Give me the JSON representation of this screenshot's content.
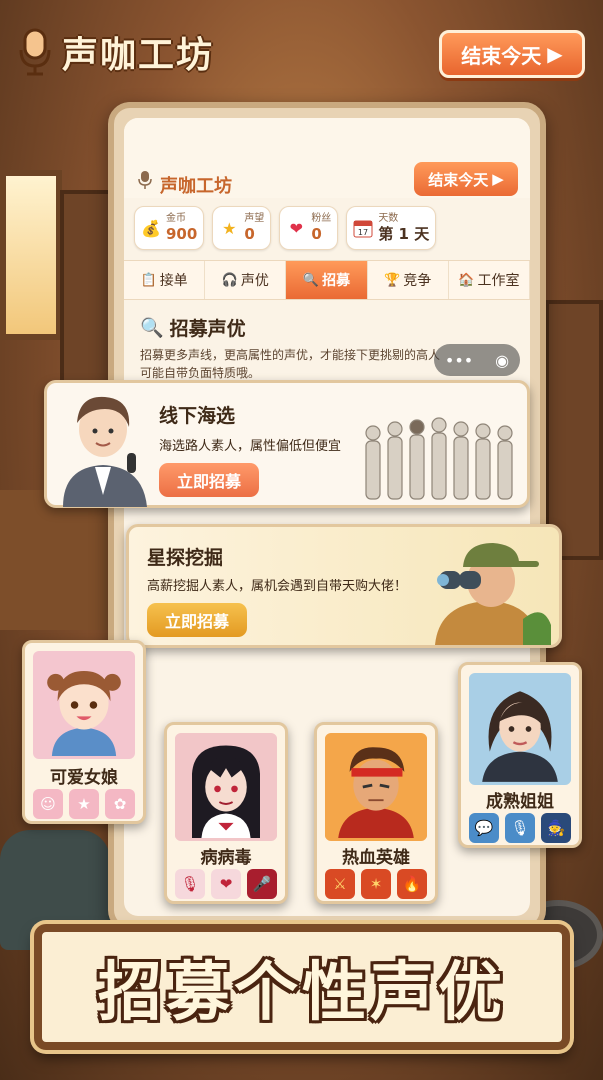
{
  "header": {
    "title": "声咖工坊",
    "end_day_label": "结束今天"
  },
  "app": {
    "title": "声咖工坊",
    "end_day_label": "结束今天"
  },
  "stats": [
    {
      "label": "金币",
      "value": "900",
      "icon": "money-bag-icon"
    },
    {
      "label": "声望",
      "value": "0",
      "icon": "star-icon"
    },
    {
      "label": "粉丝",
      "value": "0",
      "icon": "heart-icon"
    },
    {
      "label": "天数",
      "value": "第 1 天",
      "icon": "calendar-icon",
      "calendar_text": "17"
    }
  ],
  "tabs": [
    {
      "label": "接单",
      "icon": "clipboard-icon",
      "active": false
    },
    {
      "label": "声优",
      "icon": "headphones-icon",
      "active": false
    },
    {
      "label": "招募",
      "icon": "search-icon",
      "active": true
    },
    {
      "label": "竞争",
      "icon": "trophy-icon",
      "active": false
    },
    {
      "label": "工作室",
      "icon": "studio-icon",
      "active": false
    }
  ],
  "recruit": {
    "title": "招募声优",
    "description": "招募更多声线，更高属性的声优，才能接下更挑剔的高人可能自带负面特质哦。"
  },
  "options": [
    {
      "title": "线下海选",
      "description": "海选路人素人，属性偏低但便宜",
      "button": "立即招募"
    },
    {
      "title": "星探挖掘",
      "description": "高薪挖掘人素人，属机会遇到自带天购大佬！",
      "button": "立即招募"
    }
  ],
  "characters": [
    {
      "name": "可爱女娘",
      "skills": [
        "smile-icon",
        "star-icon",
        "ribbon-icon"
      ]
    },
    {
      "name": "病病毒",
      "skills": [
        "microphone-icon",
        "heart-icon",
        "microphone-icon"
      ]
    },
    {
      "name": "热血英雄",
      "skills": [
        "sword-icon",
        "slash-icon",
        "fire-icon"
      ]
    },
    {
      "name": "成熟姐姐",
      "skills": [
        "chat-icon",
        "microphone-icon",
        "wizard-icon"
      ]
    }
  ],
  "banner": {
    "text": "招募个性声优"
  }
}
